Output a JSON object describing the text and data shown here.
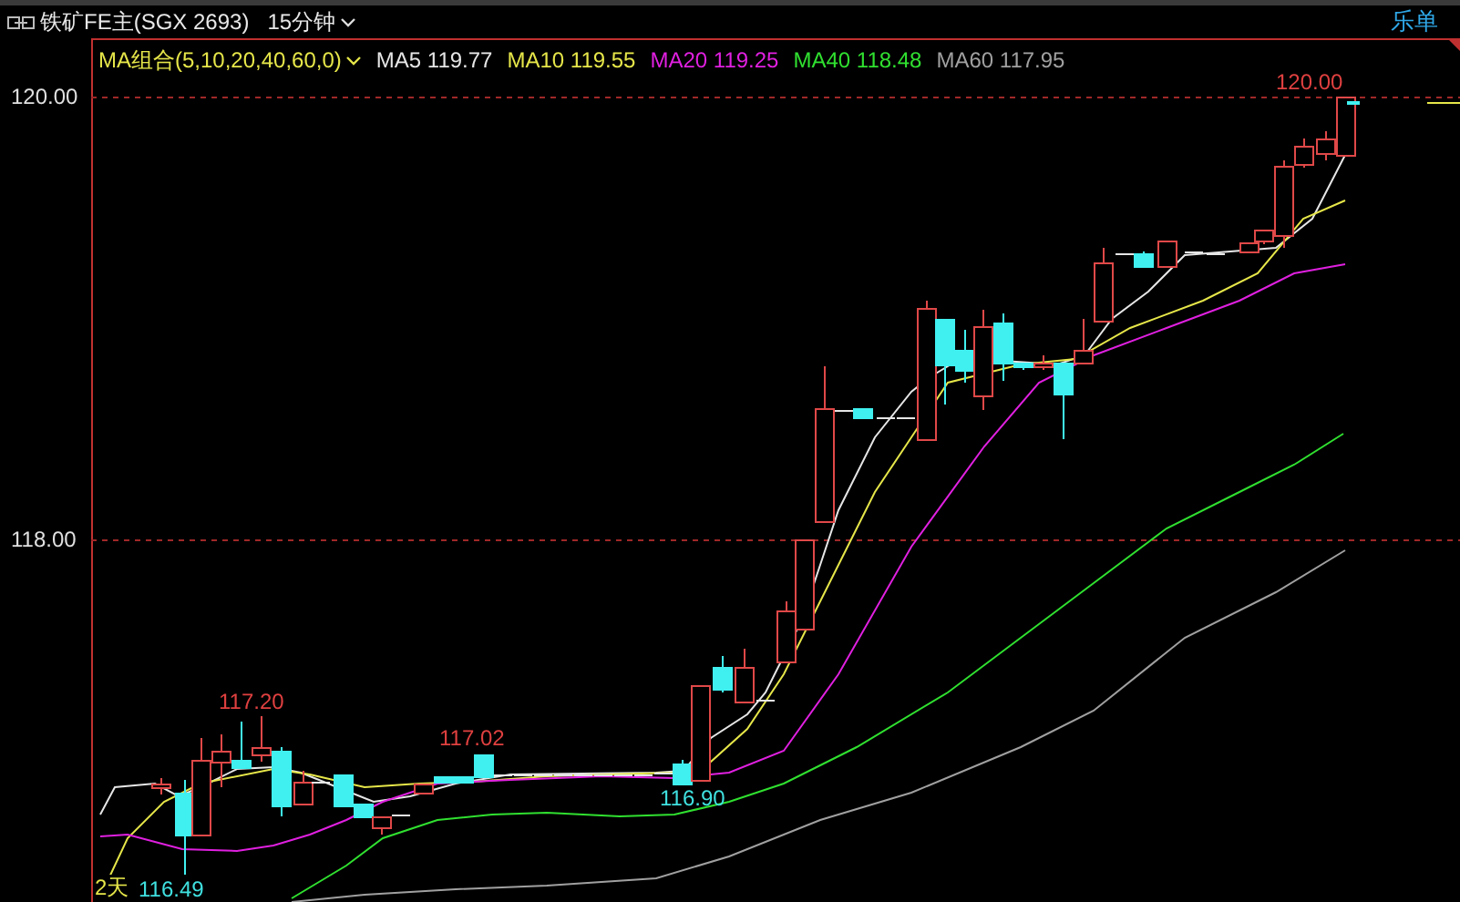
{
  "header": {
    "instrument": "铁矿FE主(SGX 2693)",
    "period": "15分钟",
    "order_button": "乐单"
  },
  "legend": {
    "indicator": "MA组合(5,10,20,40,60,0)",
    "averages": [
      {
        "label": "MA5 119.77",
        "color": "#e6e6e6"
      },
      {
        "label": "MA10 119.55",
        "color": "#e6e64a"
      },
      {
        "label": "MA20 119.25",
        "color": "#e020e0"
      },
      {
        "label": "MA40 118.48",
        "color": "#30e030"
      },
      {
        "label": "MA60 117.95",
        "color": "#a0a0a0"
      }
    ]
  },
  "chart": {
    "y_axis_labels": [
      "120.00",
      "118.00"
    ],
    "annotations": [
      {
        "text": "120.00",
        "color": "#e04040"
      },
      {
        "text": "117.20",
        "color": "#e04040"
      },
      {
        "text": "117.02",
        "color": "#e04040"
      },
      {
        "text": "116.90",
        "color": "#40e0e0"
      },
      {
        "text": "116.49",
        "color": "#40e0e0"
      }
    ],
    "range_label": "2天"
  }
}
